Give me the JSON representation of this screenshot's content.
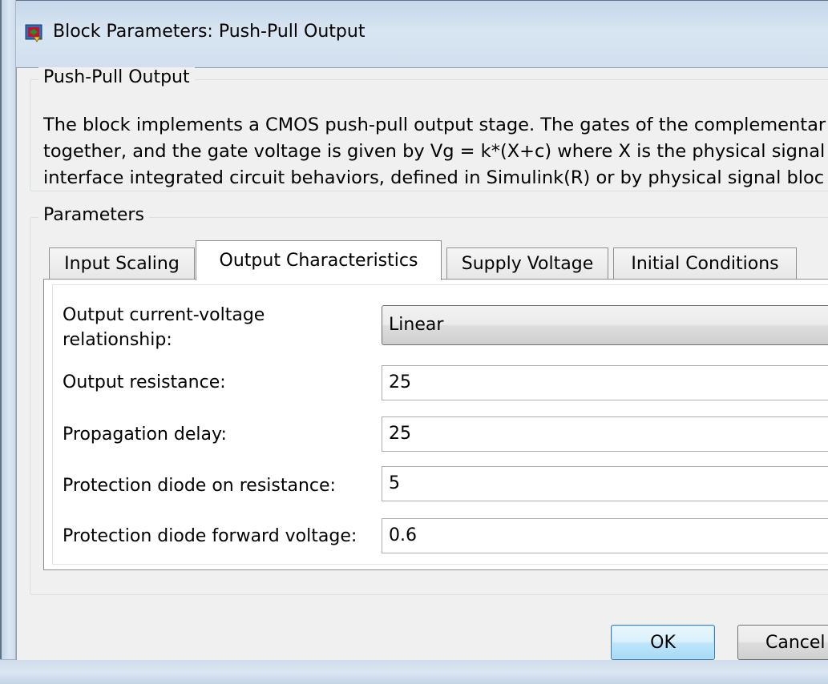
{
  "window": {
    "title": "Block Parameters: Push-Pull Output",
    "icon": "simulink-block-icon"
  },
  "block_group": {
    "label": "Push-Pull Output",
    "description_lines": [
      "The block implements a CMOS push-pull output stage. The gates of the complementar",
      "together, and the gate voltage is given by Vg = k*(X+c) where X is the physical signal",
      "interface integrated circuit behaviors, defined in Simulink(R) or by physical signal bloc"
    ]
  },
  "parameters_group": {
    "label": "Parameters"
  },
  "tabs": [
    {
      "label": "Input Scaling",
      "active": false
    },
    {
      "label": "Output Characteristics",
      "active": true
    },
    {
      "label": "Supply Voltage",
      "active": false
    },
    {
      "label": "Initial Conditions",
      "active": false
    }
  ],
  "fields": {
    "iv_relationship": {
      "label_line1": "Output current-voltage",
      "label_line2": "relationship:",
      "value": "Linear"
    },
    "output_resistance": {
      "label": "Output resistance:",
      "value": "25"
    },
    "propagation_delay": {
      "label": "Propagation delay:",
      "value": "25"
    },
    "diode_on_resistance": {
      "label": "Protection diode on resistance:",
      "value": "5"
    },
    "diode_forward_voltage": {
      "label": "Protection diode forward voltage:",
      "value": "0.6"
    }
  },
  "buttons": {
    "ok": "OK",
    "cancel": "Cancel"
  }
}
